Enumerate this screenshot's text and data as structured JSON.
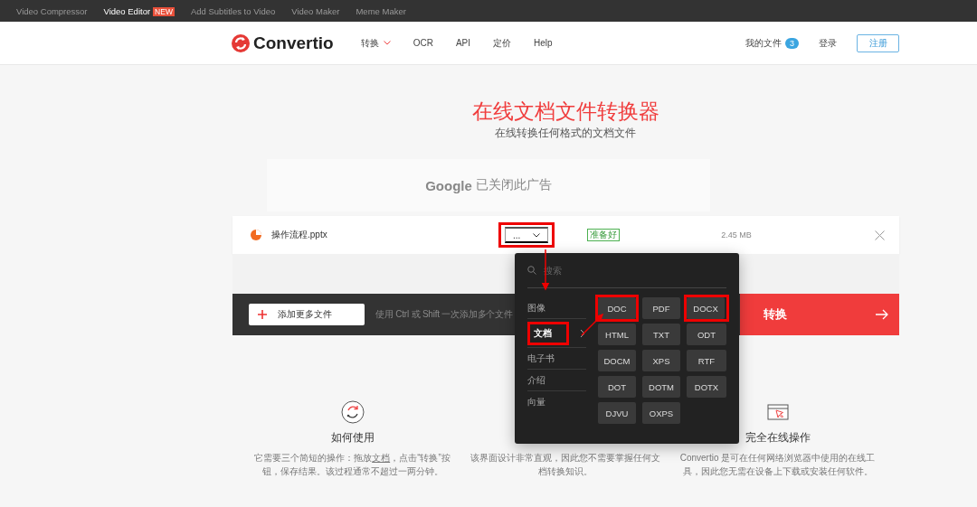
{
  "top_bar": {
    "links": [
      {
        "label": "Video Compressor",
        "selected": false
      },
      {
        "label": "Video Editor",
        "selected": true,
        "badge": "NEW"
      },
      {
        "label": "Add Subtitles to Video",
        "selected": false
      },
      {
        "label": "Video Maker",
        "selected": false
      },
      {
        "label": "Meme Maker",
        "selected": false
      }
    ]
  },
  "header": {
    "logo": "Convertio",
    "nav": [
      {
        "label": "转换",
        "dropdown": true
      },
      {
        "label": "OCR",
        "dropdown": false
      },
      {
        "label": "API",
        "dropdown": false
      },
      {
        "label": "定价",
        "dropdown": false
      },
      {
        "label": "Help",
        "dropdown": false
      }
    ],
    "my_files": {
      "label": "我的文件",
      "count": "3"
    },
    "login": "登录",
    "register": "注册"
  },
  "hero": {
    "title": "在线文档文件转换器",
    "subtitle": "在线转换任何格式的文档文件"
  },
  "ad": {
    "text_brand": "Google",
    "text": "已关闭此广告"
  },
  "file_row": {
    "name": "操作流程.pptx",
    "target": {
      "value": "...",
      "annotated": true
    },
    "status": "准备好",
    "size": "2.45 MB"
  },
  "action_bar": {
    "add_button": "添加更多文件",
    "hint": "使用 Ctrl 或 Shift 一次添加多个文件",
    "convert_button": "转换"
  },
  "dropdown": {
    "search": {
      "placeholder": "搜索"
    },
    "categories": [
      {
        "label": "图像",
        "selected": false,
        "annotated": false
      },
      {
        "label": "文档",
        "selected": true,
        "annotated": true
      },
      {
        "label": "电子书",
        "selected": false,
        "annotated": false
      },
      {
        "label": "介绍",
        "selected": false,
        "annotated": false
      },
      {
        "label": "向量",
        "selected": false,
        "annotated": false
      }
    ],
    "formats": [
      {
        "label": "DOC",
        "annotated": true
      },
      {
        "label": "PDF",
        "annotated": false
      },
      {
        "label": "DOCX",
        "annotated": true
      },
      {
        "label": "HTML",
        "annotated": false
      },
      {
        "label": "TXT",
        "annotated": false
      },
      {
        "label": "ODT",
        "annotated": false
      },
      {
        "label": "DOCM",
        "annotated": false
      },
      {
        "label": "XPS",
        "annotated": false
      },
      {
        "label": "RTF",
        "annotated": false
      },
      {
        "label": "DOT",
        "annotated": false
      },
      {
        "label": "DOTM",
        "annotated": false
      },
      {
        "label": "DOTX",
        "annotated": false
      },
      {
        "label": "DJVU",
        "annotated": false
      },
      {
        "label": "OXPS",
        "annotated": false
      }
    ]
  },
  "features": [
    {
      "kind": "convert",
      "title": "如何使用",
      "description_before": "它需要三个简短的操作：拖放",
      "link": "文档",
      "description_after": "，点击“转换”按钮，保存结果。该过程通常不超过一两分钟。"
    },
    {
      "kind": "hidden",
      "description_before": "该界面设计非常直观，因此您不需要掌握任何文档转换知识。"
    },
    {
      "kind": "browser",
      "title": "完全在线操作",
      "description_before": "Convertio 是可在任何网络浏览器中使用的在线工具，因此您无需在设备上下载或安装任何软件。"
    }
  ]
}
